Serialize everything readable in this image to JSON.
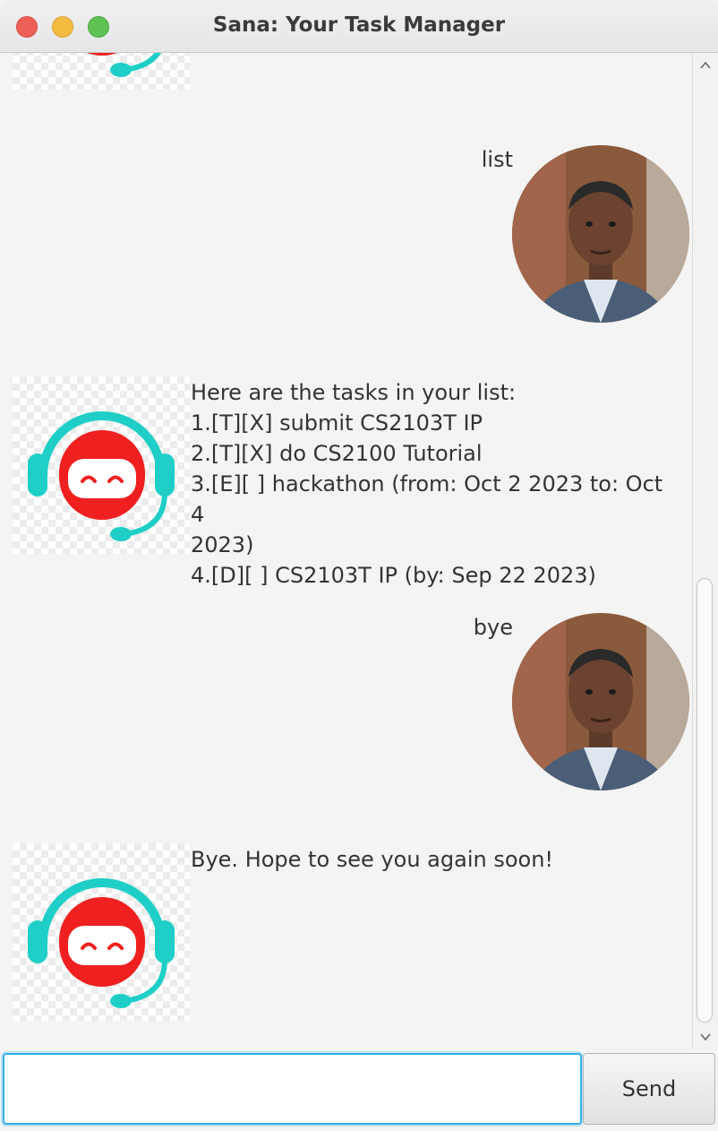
{
  "window": {
    "title": "Sana: Your Task Manager"
  },
  "dialog": [
    {
      "role": "user",
      "text": "list"
    },
    {
      "role": "bot",
      "text": "Here are the tasks in your list:\n1.[T][X] submit CS2103T IP\n2.[T][X] do CS2100 Tutorial\n3.[E][ ] hackathon (from: Oct 2 2023 to: Oct 4\n2023)\n4.[D][ ] CS2103T IP (by: Sep 22 2023)"
    },
    {
      "role": "user",
      "text": "bye"
    },
    {
      "role": "bot",
      "text": "Bye. Hope to see you again soon!"
    }
  ],
  "input": {
    "value": "",
    "send_label": "Send"
  },
  "colors": {
    "bot_headset": "#1fcfc7",
    "bot_face": "#f02020",
    "input_focus": "#37aee6"
  },
  "icons": {
    "bot_avatar": "robot-headset-icon",
    "user_avatar": "user-photo-avatar"
  }
}
